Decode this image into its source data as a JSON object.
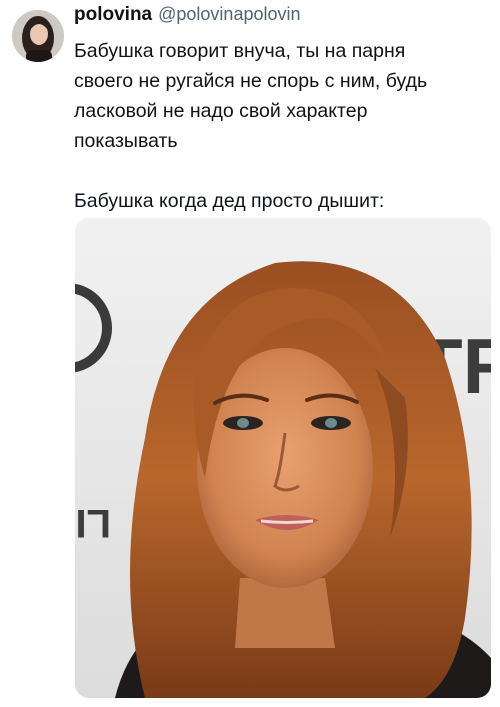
{
  "tweet": {
    "author": {
      "display_name": "polovina",
      "handle": "@polovinapolovin"
    },
    "text_lines": [
      "Бабушка говорит внуча, ты на парня",
      "своего не ругайся не спорь с ним, будь",
      "ласковой не надо свой характер",
      "показывать"
    ],
    "text_line_2": "Бабушка когда дед просто дышит:",
    "media": {
      "backdrop_text": "TR",
      "backdrop_text_mirrored": "LI"
    }
  }
}
